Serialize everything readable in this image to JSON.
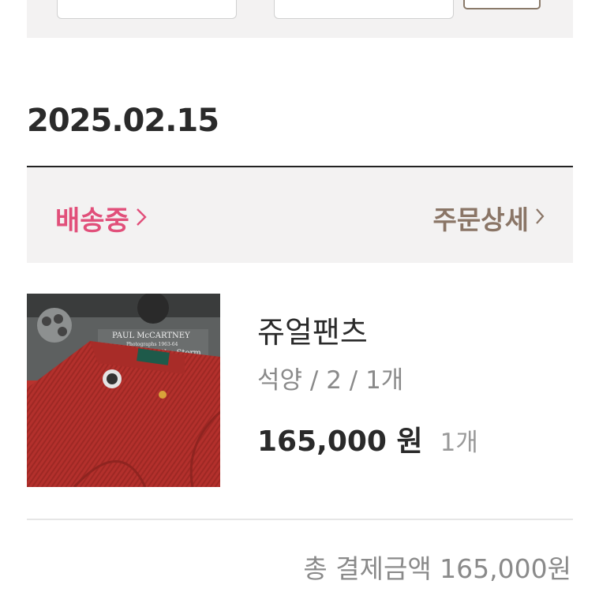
{
  "order": {
    "date": "2025.02.15",
    "status_label": "배송중",
    "detail_label": "주문상세"
  },
  "product": {
    "name": "쥬얼팬츠",
    "option": "석양 / 2 / 1개",
    "price": "165,000 원",
    "quantity": "1개",
    "image_text": {
      "line1": "PAUL McCARTNEY",
      "line2": "Photographs 1963-64",
      "line3": "Eyes of the Storm"
    }
  },
  "summary": {
    "total_label": "총 결제금액 165,000원"
  },
  "colors": {
    "status_pink": "#e14f7a",
    "detail_brown": "#8a7566",
    "panel_bg": "#f3f2f2"
  },
  "icons": {
    "status_chevron": "chevron-right-icon",
    "detail_chevron": "chevron-right-icon"
  }
}
